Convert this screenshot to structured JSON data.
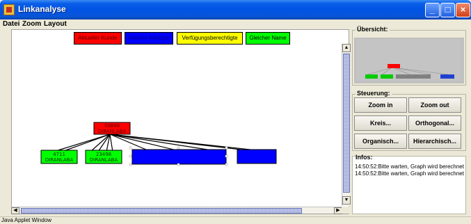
{
  "window": {
    "title": "Linkanalyse",
    "status": "Java Applet Window"
  },
  "menu": [
    "Datei",
    "Zoom",
    "Layout"
  ],
  "legend": {
    "current_customer": "Aktueller Kunde",
    "same_address": "Gleiche Adresse",
    "authorized": "Verfügungsberechtigte",
    "same_name": "Gleicher Name"
  },
  "graph": {
    "nodes": [
      {
        "id": "root",
        "line1": "50849",
        "line2": "DIRANLABA",
        "fill": "#ff0000"
      },
      {
        "id": "n1",
        "line1": "4711",
        "line2": "DIRANLABA",
        "fill": "#00ff00"
      },
      {
        "id": "n2",
        "line1": "23498",
        "line2": "DIRANLABA",
        "fill": "#00ff00"
      },
      {
        "id": "n3",
        "line1": "",
        "line2": "",
        "fill": "#0000ff"
      },
      {
        "id": "n4",
        "line1": "",
        "line2": "",
        "fill": "#0000ff"
      }
    ]
  },
  "overview": {
    "title": "Übersicht:"
  },
  "control": {
    "title": "Steuerung:",
    "zoom_in": "Zoom in",
    "zoom_out": "Zoom out",
    "circle": "Kreis...",
    "orthogonal": "Orthogonal...",
    "organic": "Organisch...",
    "hierarchical": "Hierarchisch..."
  },
  "infos": {
    "title": "Infos:",
    "log": [
      "14:50:52:Bitte warten, Graph wird berechnet",
      "14:50:52:Bitte warten, Graph wird berechnet"
    ]
  },
  "colors": {
    "current": "#ff0000",
    "address": "#0000ff",
    "authorized": "#ffff00",
    "name": "#00ff00"
  }
}
